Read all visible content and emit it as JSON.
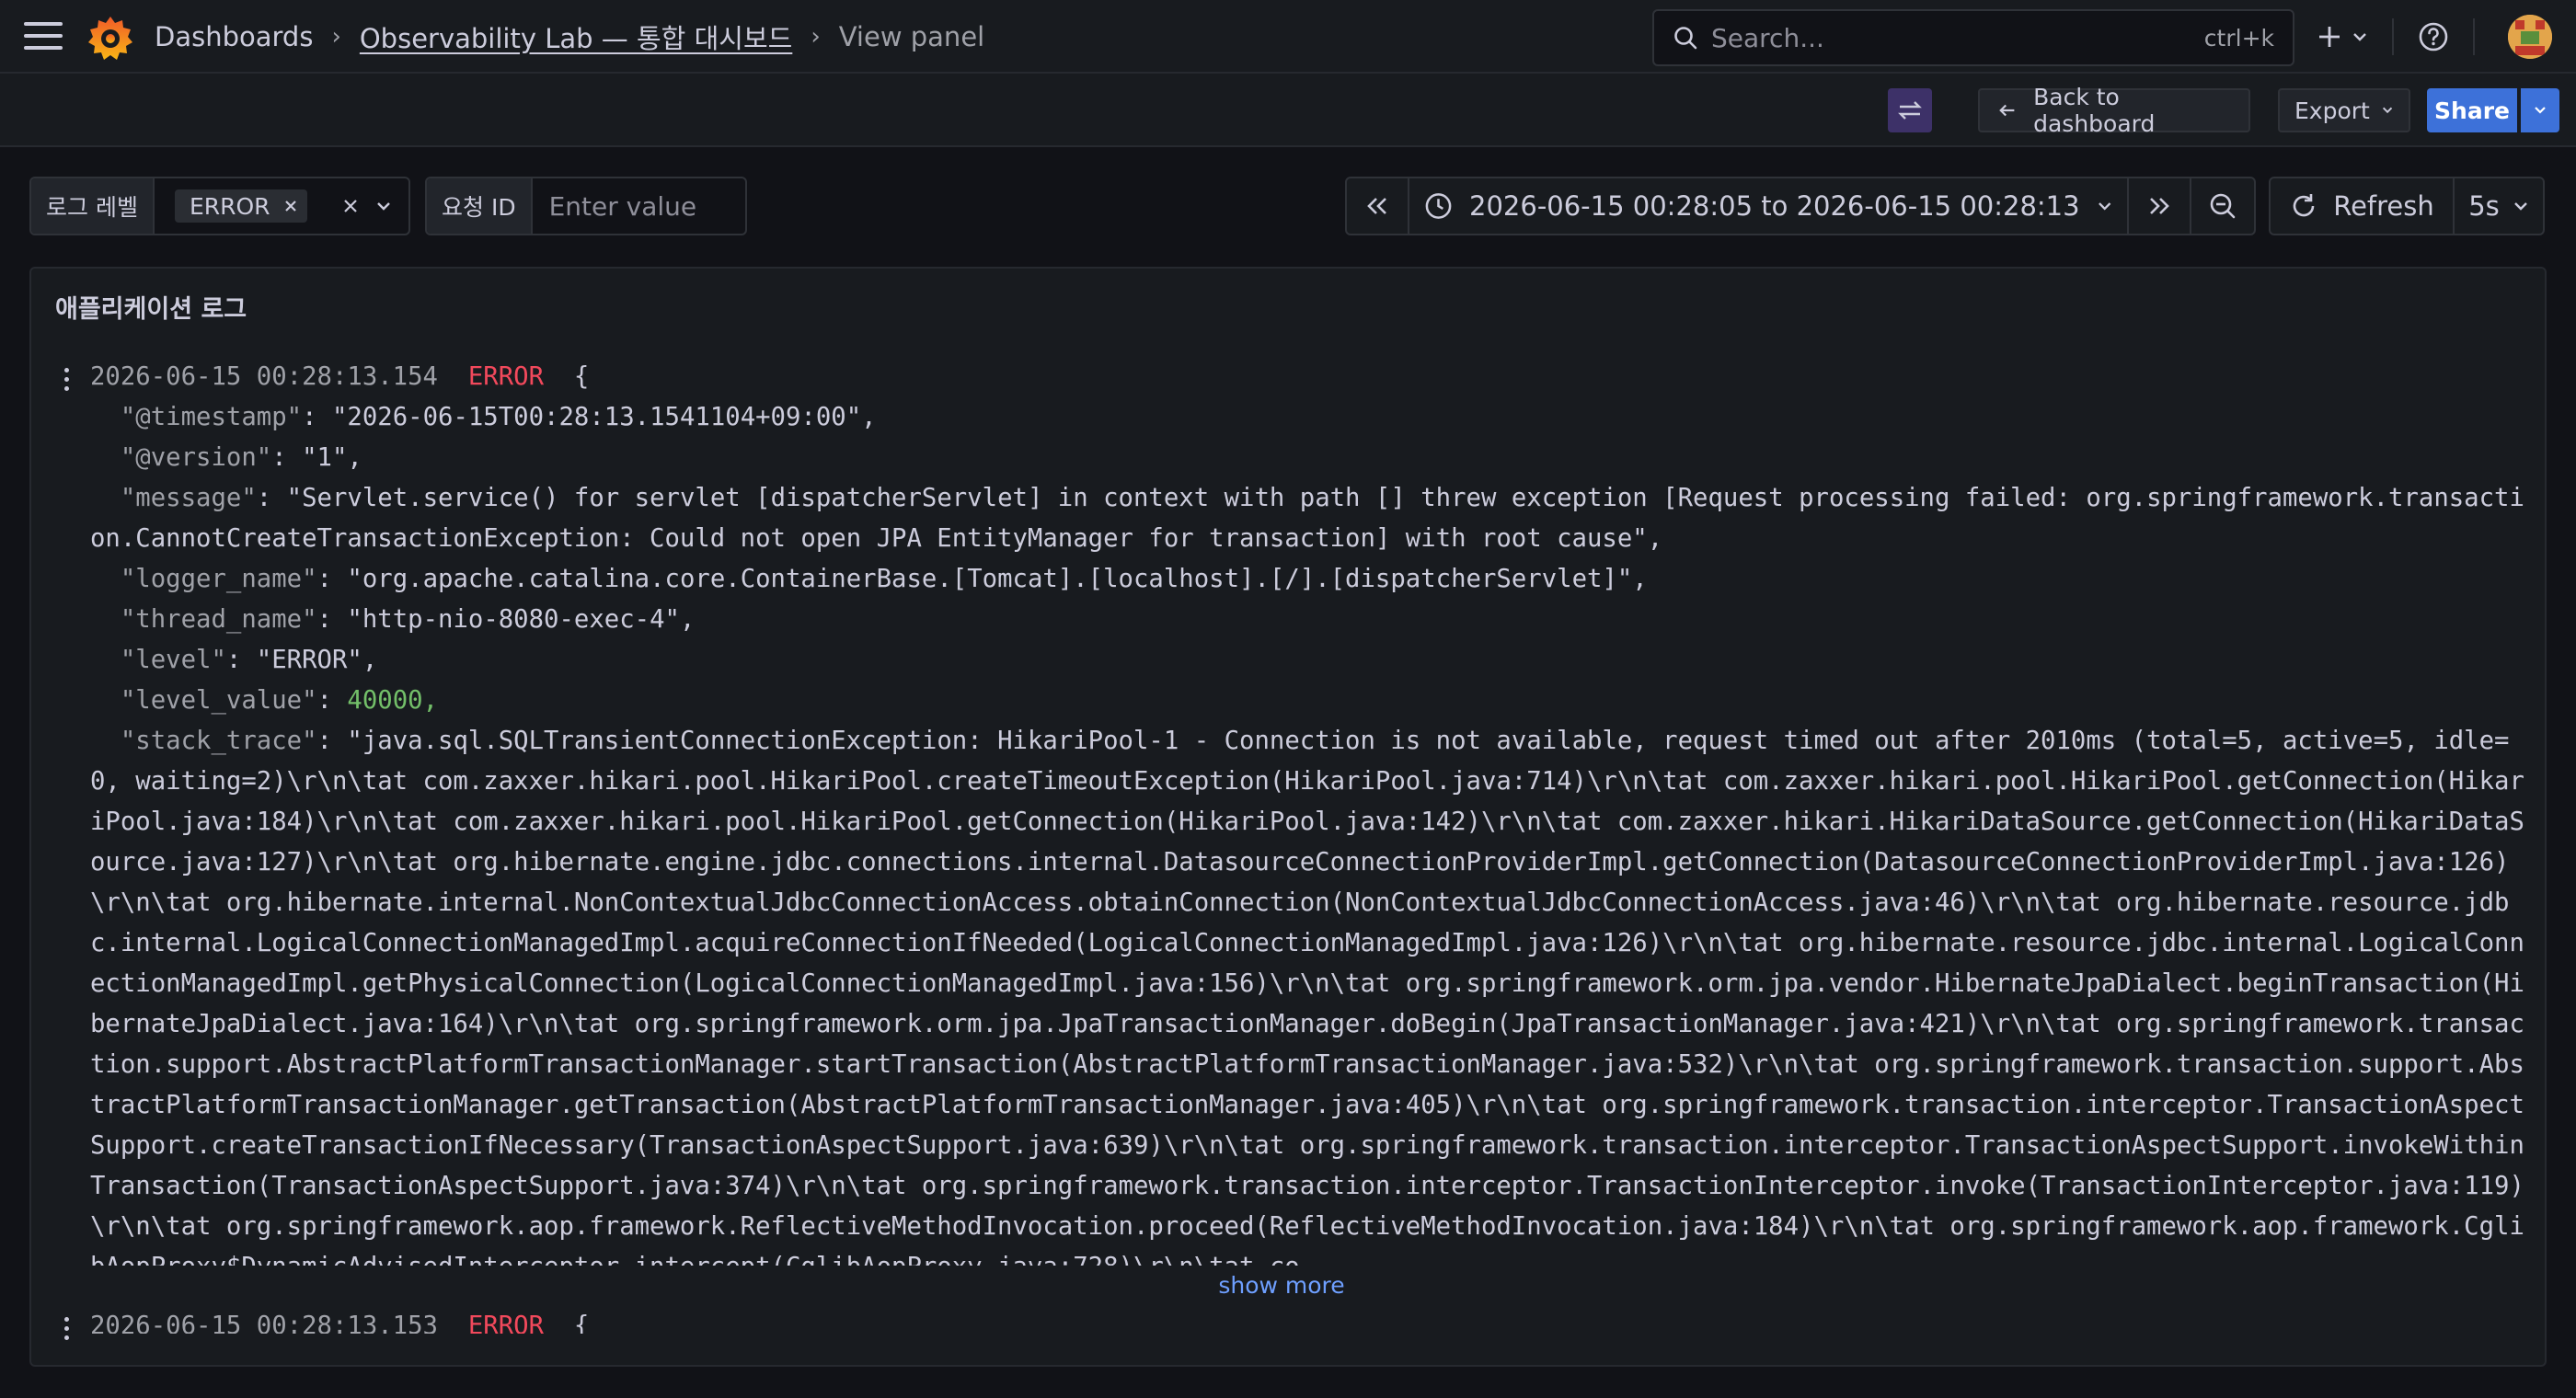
{
  "nav": {
    "breadcrumbs": [
      "Dashboards",
      "Observability Lab — 통합 대시보드",
      "View panel"
    ],
    "search_placeholder": "Search...",
    "search_shortcut": "ctrl+k"
  },
  "toolbar": {
    "back_label": "Back to dashboard",
    "export_label": "Export",
    "share_label": "Share"
  },
  "variables": [
    {
      "label": "로그 레벨",
      "selected": "ERROR"
    },
    {
      "label": "요청 ID",
      "placeholder": "Enter value"
    }
  ],
  "time": {
    "range": "2026-06-15 00:28:05 to 2026-06-15 00:28:13",
    "refresh_label": "Refresh",
    "interval": "5s"
  },
  "panel": {
    "title": "애플리케이션 로그",
    "show_more_label": "show more",
    "logs": [
      {
        "timestamp": "2026-06-15 00:28:13.154",
        "level": "ERROR",
        "open": "{",
        "fields": [
          {
            "key": "\"@timestamp\"",
            "value": "\"2026-06-15T00:28:13.1541104+09:00\","
          },
          {
            "key": "\"@version\"",
            "value": "\"1\","
          },
          {
            "key": "\"message\"",
            "value": "\"Servlet.service() for servlet [dispatcherServlet] in context with path [] threw exception [Request processing failed: org.springframework.transaction.CannotCreateTransactionException: Could not open JPA EntityManager for transaction] with root cause\","
          },
          {
            "key": "\"logger_name\"",
            "value": "\"org.apache.catalina.core.ContainerBase.[Tomcat].[localhost].[/].[dispatcherServlet]\","
          },
          {
            "key": "\"thread_name\"",
            "value": "\"http-nio-8080-exec-4\","
          },
          {
            "key": "\"level\"",
            "value": "\"ERROR\","
          },
          {
            "key": "\"level_value\"",
            "value": "40000,"
          },
          {
            "key": "\"stack_trace\"",
            "value": "\"java.sql.SQLTransientConnectionException: HikariPool-1 - Connection is not available, request timed out after 2010ms (total=5, active=5, idle=0, waiting=2)\\r\\n\\tat com.zaxxer.hikari.pool.HikariPool.createTimeoutException(HikariPool.java:714)\\r\\n\\tat com.zaxxer.hikari.pool.HikariPool.getConnection(HikariPool.java:184)\\r\\n\\tat com.zaxxer.hikari.pool.HikariPool.getConnection(HikariPool.java:142)\\r\\n\\tat com.zaxxer.hikari.HikariDataSource.getConnection(HikariDataSource.java:127)\\r\\n\\tat org.hibernate.engine.jdbc.connections.internal.DatasourceConnectionProviderImpl.getConnection(DatasourceConnectionProviderImpl.java:126)\\r\\n\\tat org.hibernate.internal.NonContextualJdbcConnectionAccess.obtainConnection(NonContextualJdbcConnectionAccess.java:46)\\r\\n\\tat org.hibernate.resource.jdbc.internal.LogicalConnectionManagedImpl.acquireConnectionIfNeeded(LogicalConnectionManagedImpl.java:126)\\r\\n\\tat org.hibernate.resource.jdbc.internal.LogicalConnectionManagedImpl.getPhysicalConnection(LogicalConnectionManagedImpl.java:156)\\r\\n\\tat org.springframework.orm.jpa.vendor.HibernateJpaDialect.beginTransaction(HibernateJpaDialect.java:164)\\r\\n\\tat org.springframework.orm.jpa.JpaTransactionManager.doBegin(JpaTransactionManager.java:421)\\r\\n\\tat org.springframework.transaction.support.AbstractPlatformTransactionManager.startTransaction(AbstractPlatformTransactionManager.java:532)\\r\\n\\tat org.springframework.transaction.support.AbstractPlatformTransactionManager.getTransaction(AbstractPlatformTransactionManager.java:405)\\r\\n\\tat org.springframework.transaction.interceptor.TransactionAspectSupport.createTransactionIfNecessary(TransactionAspectSupport.java:639)\\r\\n\\tat org.springframework.transaction.interceptor.TransactionAspectSupport.invokeWithinTransaction(TransactionAspectSupport.java:374)\\r\\n\\tat org.springframework.transaction.interceptor.TransactionInterceptor.invoke(TransactionInterceptor.java:119)\\r\\n\\tat org.springframework.aop.framework.ReflectiveMethodInvocation.proceed(ReflectiveMethodInvocation.java:184)\\r\\n\\tat org.springframework.aop.framework.CglibAopProxy$DynamicAdvisedInterceptor.intercept(CglibAopProxy.java:728)\\r\\n\\tat co"
          }
        ]
      },
      {
        "timestamp": "2026-06-15 00:28:13.153",
        "level": "ERROR",
        "open": "{"
      }
    ]
  },
  "colors": {
    "background": "#111217",
    "panel": "#181b1f",
    "error": "#f2495c",
    "number": "#73bf69",
    "primary": "#3d71d9",
    "link": "#6e9fff"
  }
}
